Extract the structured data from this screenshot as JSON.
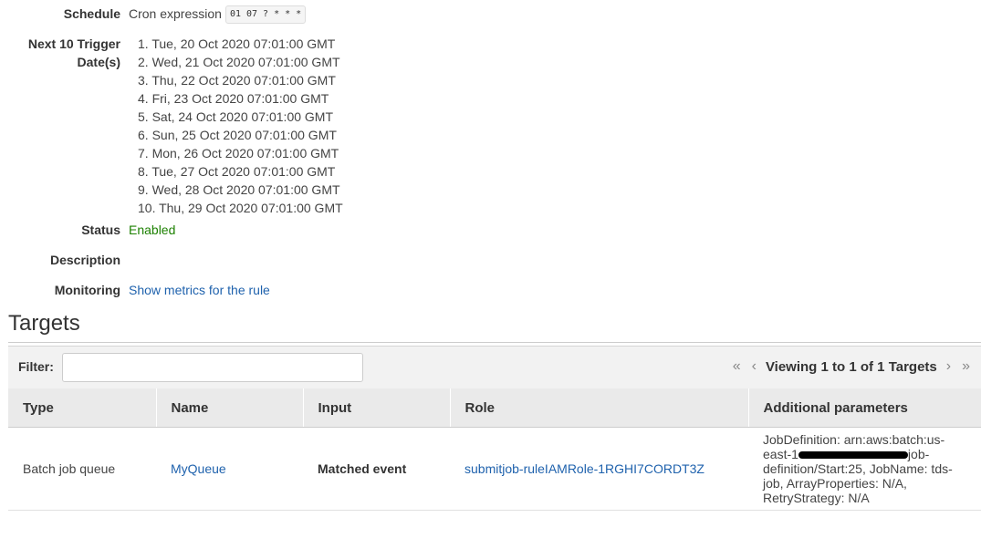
{
  "details": {
    "schedule_label": "Schedule",
    "schedule_type": "Cron expression",
    "cron": "01 07 ? * * *",
    "trigger_label_1": "Next 10 Trigger",
    "trigger_label_2": "Date(s)",
    "trigger_dates": [
      "1. Tue, 20 Oct 2020 07:01:00 GMT",
      "2. Wed, 21 Oct 2020 07:01:00 GMT",
      "3. Thu, 22 Oct 2020 07:01:00 GMT",
      "4. Fri, 23 Oct 2020 07:01:00 GMT",
      "5. Sat, 24 Oct 2020 07:01:00 GMT",
      "6. Sun, 25 Oct 2020 07:01:00 GMT",
      "7. Mon, 26 Oct 2020 07:01:00 GMT",
      "8. Tue, 27 Oct 2020 07:01:00 GMT",
      "9. Wed, 28 Oct 2020 07:01:00 GMT",
      "10. Thu, 29 Oct 2020 07:01:00 GMT"
    ],
    "status_label": "Status",
    "status_value": "Enabled",
    "description_label": "Description",
    "monitoring_label": "Monitoring",
    "monitoring_link": "Show metrics for the rule"
  },
  "targets": {
    "heading": "Targets",
    "filter_label": "Filter:",
    "filter_value": "",
    "pager_text": "Viewing 1 to 1 of 1 Targets",
    "icons": {
      "first": "double-chevron-left-icon",
      "prev": "chevron-left-icon",
      "next": "chevron-right-icon",
      "last": "double-chevron-right-icon"
    },
    "columns": [
      "Type",
      "Name",
      "Input",
      "Role",
      "Additional parameters"
    ],
    "rows": [
      {
        "type": "Batch job queue",
        "name": "MyQueue",
        "input": "Matched event",
        "role": "submitjob-ruleIAMRole-1RGHI7CORDT3Z",
        "addl_part1": "JobDefinition: arn:aws:batch:us-east-1",
        "addl_part2": "job-definition/Start:25, JobName: tds-job, ArrayProperties: N/A, RetryStrategy: N/A"
      }
    ]
  },
  "colors": {
    "link": "#1f62ad",
    "enabled": "#1d8102"
  }
}
